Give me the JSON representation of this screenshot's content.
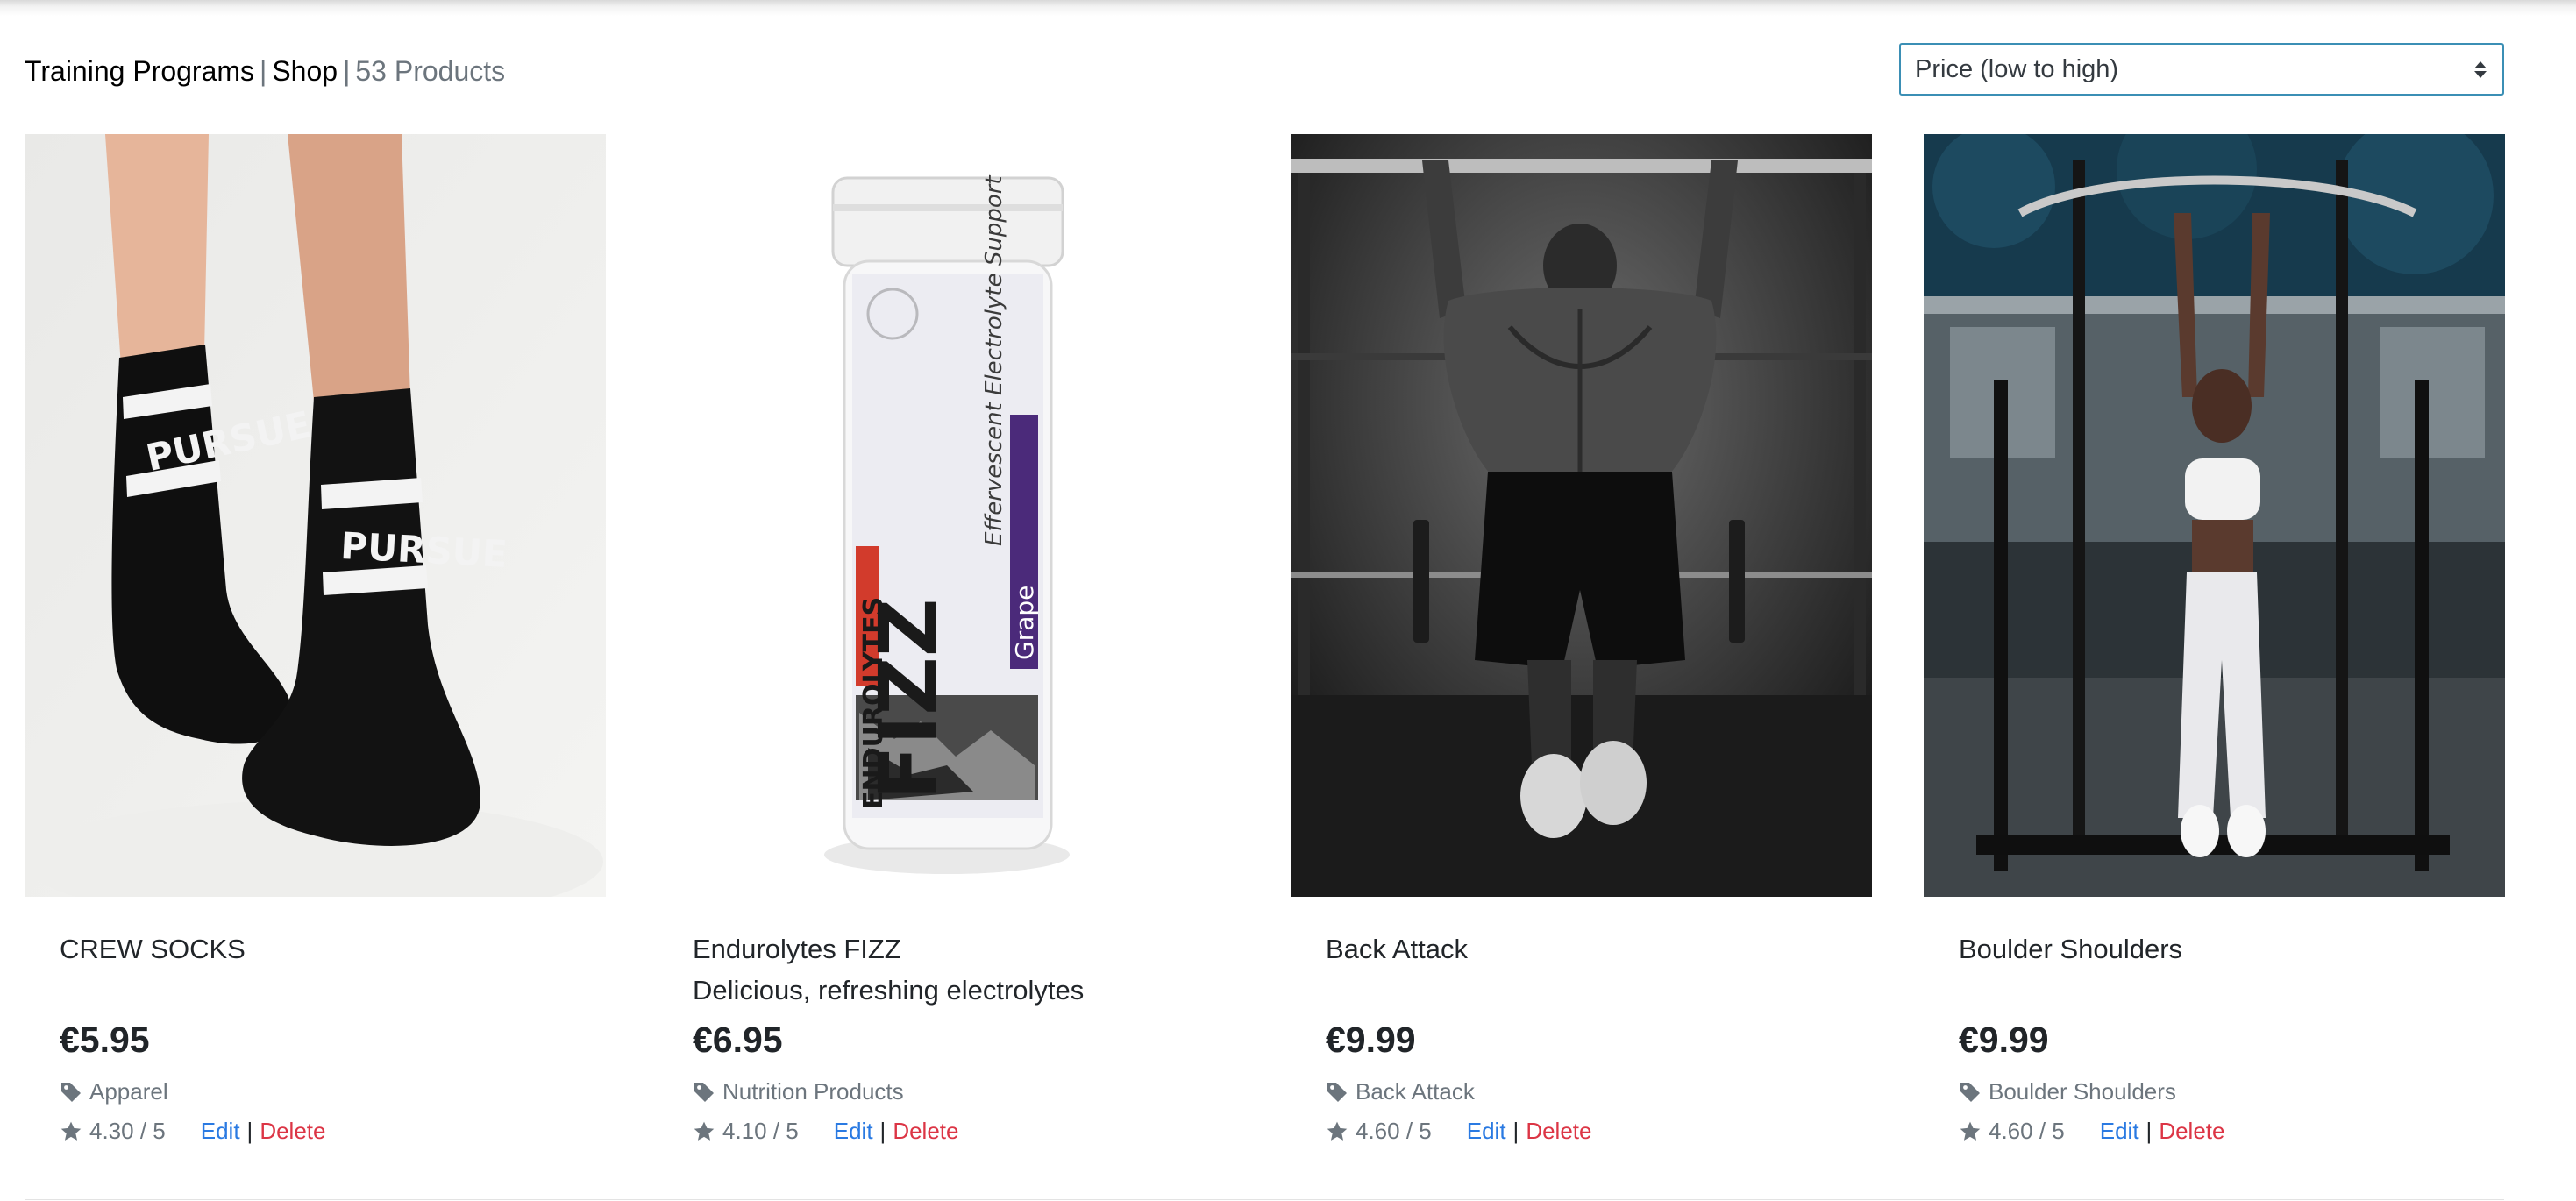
{
  "breadcrumb": {
    "training_programs": "Training Programs",
    "separator": "|",
    "shop": "Shop",
    "count": "53 Products"
  },
  "sort": {
    "selected": "Price (low to high)"
  },
  "products": [
    {
      "name": "CREW SOCKS",
      "description": "",
      "price": "€5.95",
      "category": "Apparel",
      "rating": "4.30 / 5",
      "edit_label": "Edit",
      "delete_label": "Delete",
      "image_text_1": "PURSUE",
      "image_text_2": "PURSUE"
    },
    {
      "name": "Endurolytes FIZZ",
      "description": "Delicious, refreshing electrolytes",
      "price": "€6.95",
      "category": "Nutrition Products",
      "rating": "4.10 / 5",
      "edit_label": "Edit",
      "delete_label": "Delete",
      "image_text_brand": "ENDUROLYTES",
      "image_text_fizz": "FIZZ",
      "image_text_flavor": "Grape",
      "image_text_support": "Effervescent Electrolyte Support"
    },
    {
      "name": "Back Attack",
      "description": "",
      "price": "€9.99",
      "category": "Back Attack",
      "rating": "4.60 / 5",
      "edit_label": "Edit",
      "delete_label": "Delete"
    },
    {
      "name": "Boulder Shoulders",
      "description": "",
      "price": "€9.99",
      "category": "Boulder Shoulders",
      "rating": "4.60 / 5",
      "edit_label": "Edit",
      "delete_label": "Delete"
    }
  ],
  "icons": {
    "category": "tag-icon",
    "rating": "star-icon",
    "sort": "sort-arrows-icon"
  },
  "colors": {
    "edit": "#2a7ae2",
    "delete": "#dc3545",
    "muted": "#6c757d",
    "select_border": "#3b8fb5"
  }
}
